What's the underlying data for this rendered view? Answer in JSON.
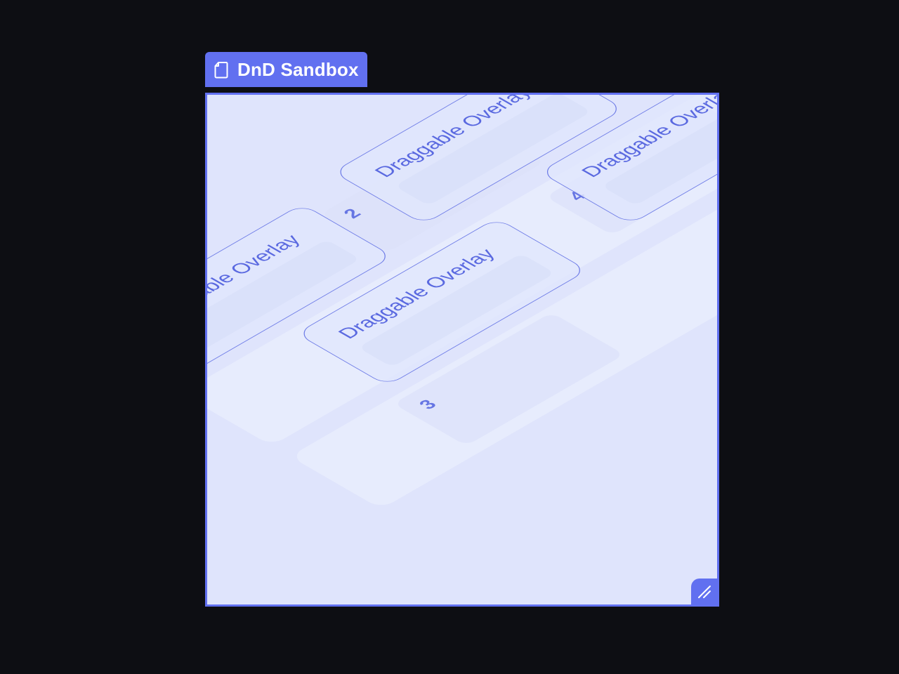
{
  "window": {
    "title": "DnD Sandbox",
    "icon": "document-icon",
    "accent": "#6170f0",
    "canvas_color": "#dfe4fc",
    "background": "#0d0e13"
  },
  "sandbox": {
    "droppables": [
      {
        "number": "2"
      },
      {
        "number": "3"
      },
      {
        "number": "4"
      }
    ],
    "cards": [
      {
        "label": "Draggable Overlay"
      },
      {
        "label": "Draggable Overlay"
      },
      {
        "label": "Draggable Overlay"
      },
      {
        "label": "Draggable Overlay"
      }
    ],
    "resize_icon": "resize-handle-icon"
  }
}
